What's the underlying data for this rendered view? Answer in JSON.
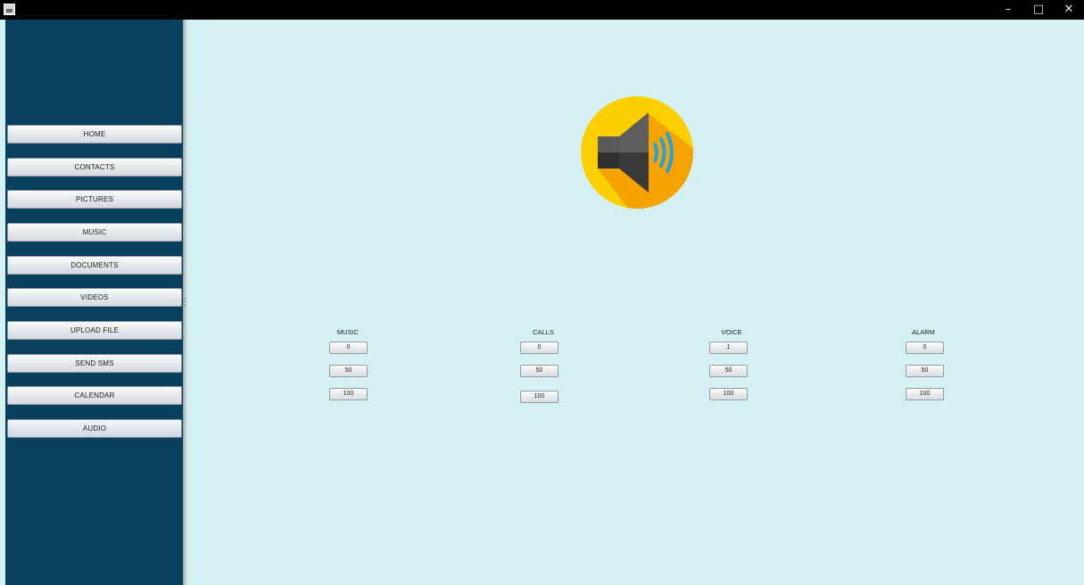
{
  "window": {
    "controls": {
      "minimize": "–",
      "maximize": "□",
      "close": "✕"
    }
  },
  "sidebar": {
    "items": [
      {
        "label": "HOME"
      },
      {
        "label": "CONTACTS"
      },
      {
        "label": "PICTURES"
      },
      {
        "label": "MUSIC"
      },
      {
        "label": "DOCUMENTS"
      },
      {
        "label": "VIDEOS"
      },
      {
        "label": "UPLOAD FILE"
      },
      {
        "label": "SEND SMS"
      },
      {
        "label": "CALENDAR"
      },
      {
        "label": "AUDIO",
        "selected": true
      }
    ]
  },
  "main": {
    "icon": "speaker-volume-icon",
    "colors": {
      "circle": "#fcd000",
      "shadow": "#f5a300",
      "waves": "#1ea1e6",
      "speaker": "#4a4a4a"
    },
    "volume_groups": [
      {
        "label": "MUSIC",
        "values": [
          "0",
          "50",
          "100"
        ]
      },
      {
        "label": "CALLS",
        "values": [
          "0",
          "50",
          "100"
        ]
      },
      {
        "label": "VOICE",
        "values": [
          "1",
          "50",
          "100"
        ]
      },
      {
        "label": "ALARM",
        "values": [
          "0",
          "50",
          "100"
        ]
      }
    ]
  }
}
